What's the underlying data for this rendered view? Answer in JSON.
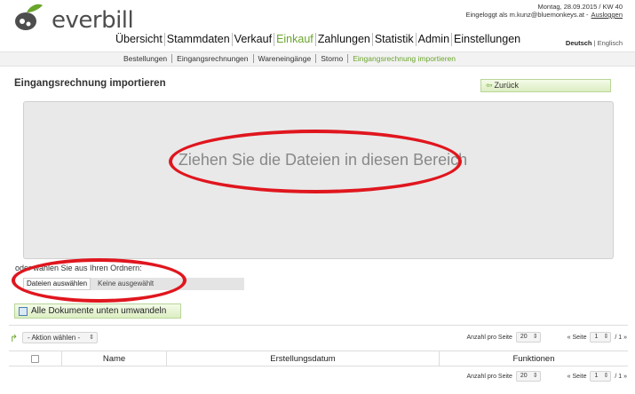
{
  "app": {
    "logo_text": "everbill",
    "date_line": "Montag, 28.09.2015 / KW 40",
    "login_text": "Eingeloggt als m.kunz@bluemonkeys.at -",
    "logout_label": "Ausloggen"
  },
  "nav": {
    "items": [
      "Übersicht",
      "Stammdaten",
      "Verkauf",
      "Einkauf",
      "Zahlungen",
      "Statistik",
      "Admin",
      "Einstellungen"
    ],
    "active": "Einkauf"
  },
  "lang": {
    "current": "Deutsch",
    "separator": "|",
    "other": "Englisch"
  },
  "subnav": {
    "items": [
      "Bestellungen",
      "Eingangsrechnungen",
      "Wareneingänge",
      "Storno",
      "Eingangsrechnung importieren"
    ],
    "active": "Eingangsrechnung importieren"
  },
  "page": {
    "title": "Eingangsrechnung importieren",
    "back_label": "Zurück",
    "dropzone_text": "Ziehen Sie die Dateien in diesen Bereich",
    "choose_label": "oder wählen Sie aus Ihren Ordnern:",
    "file_button": "Dateien auswählen",
    "file_status": "Keine ausgewählt",
    "convert_label": "Alle Dokumente unten umwandeln"
  },
  "table": {
    "action_select": "- Aktion wählen -",
    "per_page_label": "Anzahl pro Seite",
    "per_page_value": "20",
    "page_prefix": "« Seite",
    "page_value": "1",
    "page_total": "/ 1 »",
    "columns": [
      "",
      "Name",
      "Erstellungsdatum",
      "Funktionen"
    ]
  },
  "colors": {
    "accent": "#6aa52b",
    "annotation": "#e0161e"
  }
}
